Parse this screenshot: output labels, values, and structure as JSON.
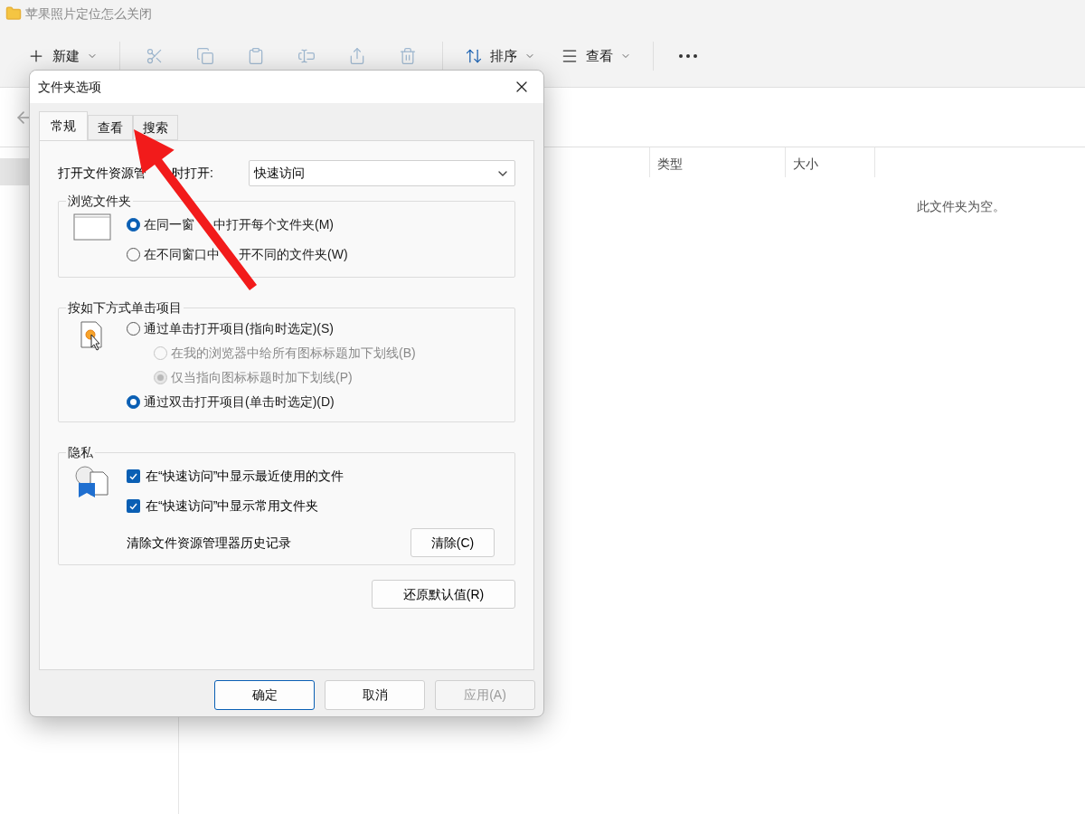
{
  "explorer": {
    "title": "苹果照片定位怎么关闭",
    "toolbar": [
      {
        "kind": "new",
        "label": "新建",
        "disabled": false
      },
      {
        "kind": "cut",
        "disabled": true
      },
      {
        "kind": "copy",
        "disabled": true
      },
      {
        "kind": "paste",
        "disabled": true
      },
      {
        "kind": "rename",
        "disabled": true
      },
      {
        "kind": "share",
        "disabled": true
      },
      {
        "kind": "delete",
        "disabled": true
      },
      {
        "kind": "sort",
        "label": "排序",
        "disabled": false
      },
      {
        "kind": "view",
        "label": "查看",
        "disabled": false
      },
      {
        "kind": "more",
        "disabled": false
      }
    ],
    "columns": [
      "类型",
      "大小"
    ],
    "empty_message": "此文件夹为空。"
  },
  "dialog": {
    "title": "文件夹选项",
    "tabs": [
      {
        "label": "常规",
        "selected": true
      },
      {
        "label": "查看",
        "selected": false
      },
      {
        "label": "搜索",
        "selected": false
      }
    ],
    "open_in": {
      "label_parts": [
        "打开文件资源管",
        "时打开:"
      ],
      "value": "快速访问"
    },
    "browse": {
      "title": "浏览文件夹",
      "options": [
        {
          "label_parts": [
            "在同一窗",
            "中打开每个文件夹(M)"
          ],
          "selected": true
        },
        {
          "label_parts": [
            "在不同窗口中",
            "开不同的文件夹(W)"
          ],
          "selected": false
        }
      ]
    },
    "click": {
      "title": "按如下方式单击项目",
      "options": [
        {
          "label": "通过单击打开项目(指向时选定)(S)",
          "selected": false,
          "disabled": false,
          "children": [
            {
              "label": "在我的浏览器中给所有图标标题加下划线(B)",
              "selected": false,
              "disabled": true
            },
            {
              "label": "仅当指向图标标题时加下划线(P)",
              "selected": true,
              "disabled": true
            }
          ]
        },
        {
          "label": "通过双击打开项目(单击时选定)(D)",
          "selected": true,
          "disabled": false
        }
      ]
    },
    "privacy": {
      "title": "隐私",
      "checks": [
        {
          "label": "在“快速访问”中显示最近使用的文件",
          "checked": true
        },
        {
          "label": "在“快速访问”中显示常用文件夹",
          "checked": true
        }
      ],
      "clear_label": "清除文件资源管理器历史记录",
      "clear_button": "清除(C)"
    },
    "restore_button": "还原默认值(R)",
    "buttons": [
      {
        "label": "确定",
        "kind": "default",
        "disabled": false
      },
      {
        "label": "取消",
        "kind": "normal",
        "disabled": false
      },
      {
        "label": "应用(A)",
        "kind": "normal",
        "disabled": true
      }
    ]
  }
}
